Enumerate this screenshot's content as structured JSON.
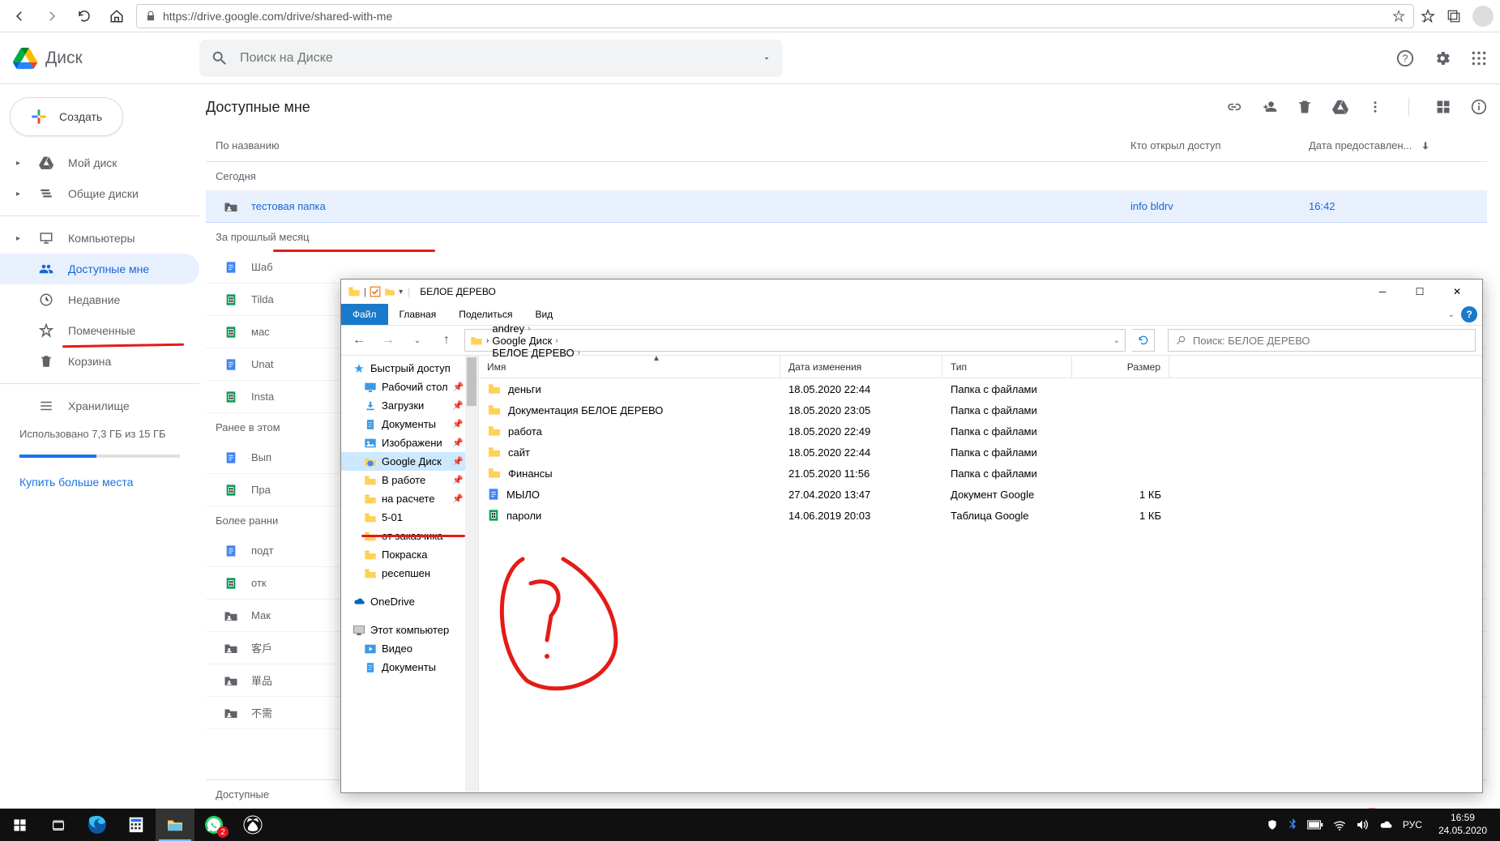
{
  "browser": {
    "url": "https://drive.google.com/drive/shared-with-me"
  },
  "drive": {
    "app_name": "Диск",
    "search_placeholder": "Поиск на Диске",
    "create_label": "Создать",
    "sidebar": [
      {
        "label": "Мой диск",
        "active": false,
        "expandable": true
      },
      {
        "label": "Общие диски",
        "active": false,
        "expandable": true
      },
      {
        "label": "Компьютеры",
        "active": false,
        "expandable": true,
        "sep_before": true
      },
      {
        "label": "Доступные мне",
        "active": true,
        "expandable": false
      },
      {
        "label": "Недавние",
        "active": false,
        "expandable": false
      },
      {
        "label": "Помеченные",
        "active": false,
        "expandable": false
      },
      {
        "label": "Корзина",
        "active": false,
        "expandable": false
      },
      {
        "label": "Хранилище",
        "active": false,
        "expandable": false,
        "sep_before": true
      }
    ],
    "storage_text": "Использовано 7,3 ГБ из 15 ГБ",
    "storage_link": "Купить больше места",
    "main_title": "Доступные мне",
    "columns": {
      "name": "По названию",
      "owner": "Кто открыл доступ",
      "date": "Дата предоставлен..."
    },
    "groups": [
      {
        "label": "Сегодня",
        "rows": [
          {
            "name": "тестовая папка",
            "owner": "info bldrv",
            "date": "16:42",
            "type": "folder-shared",
            "selected": true
          }
        ]
      },
      {
        "label": "За прошлый месяц",
        "rows": [
          {
            "name": "Шаб",
            "type": "doc"
          },
          {
            "name": "Tilda",
            "type": "sheet"
          },
          {
            "name": "мас",
            "type": "sheet"
          },
          {
            "name": "Unat",
            "type": "doc"
          },
          {
            "name": "Insta",
            "type": "sheet"
          }
        ]
      },
      {
        "label": "Ранее в этом",
        "rows": [
          {
            "name": "Вып",
            "type": "doc"
          },
          {
            "name": "Пра",
            "type": "sheet"
          }
        ]
      },
      {
        "label": "Более ранни",
        "rows": [
          {
            "name": "подт",
            "type": "doc"
          },
          {
            "name": "отк",
            "type": "sheet"
          },
          {
            "name": "Мак",
            "type": "folder-shared"
          },
          {
            "name": "客戶",
            "type": "folder-shared"
          },
          {
            "name": "單品",
            "type": "folder-shared"
          },
          {
            "name": "不需",
            "type": "folder-shared"
          }
        ]
      }
    ],
    "footer_label": "Доступные"
  },
  "explorer": {
    "title": "БЕЛОЕ ДЕРЕВО",
    "tabs": {
      "file": "Файл",
      "home": "Главная",
      "share": "Поделиться",
      "view": "Вид"
    },
    "address": [
      "andrey",
      "Google Диск",
      "БЕЛОЕ ДЕРЕВО"
    ],
    "search_placeholder": "Поиск: БЕЛОЕ ДЕРЕВО",
    "columns": {
      "name": "Имя",
      "date": "Дата изменения",
      "type": "Тип",
      "size": "Размер"
    },
    "tree": [
      {
        "label": "Быстрый доступ",
        "icon": "star",
        "bold": true
      },
      {
        "label": "Рабочий стол",
        "icon": "desktop",
        "pin": true,
        "sub": true
      },
      {
        "label": "Загрузки",
        "icon": "download",
        "pin": true,
        "sub": true
      },
      {
        "label": "Документы",
        "icon": "docs",
        "pin": true,
        "sub": true
      },
      {
        "label": "Изображени",
        "icon": "pics",
        "pin": true,
        "sub": true
      },
      {
        "label": "Google Диск",
        "icon": "gdrive",
        "pin": true,
        "sub": true,
        "sel": true
      },
      {
        "label": "В работе",
        "icon": "gfolder",
        "pin": true,
        "sub": true
      },
      {
        "label": "на расчете",
        "icon": "gfolder",
        "pin": true,
        "sub": true
      },
      {
        "label": "5-01",
        "icon": "gfolder",
        "sub": true
      },
      {
        "label": "от заказчика",
        "icon": "gfolder",
        "sub": true
      },
      {
        "label": "Покраска",
        "icon": "gfolder",
        "sub": true
      },
      {
        "label": "ресепшен",
        "icon": "gfolder",
        "sub": true
      },
      {
        "label": "OneDrive",
        "icon": "onedrive",
        "bold": true,
        "gap_before": true
      },
      {
        "label": "Этот компьютер",
        "icon": "pc",
        "bold": true,
        "gap_before": true
      },
      {
        "label": "Видео",
        "icon": "video",
        "sub": true
      },
      {
        "label": "Документы",
        "icon": "docs",
        "sub": true
      }
    ],
    "rows": [
      {
        "name": "деньги",
        "date": "18.05.2020 22:44",
        "type": "Папка с файлами",
        "size": "",
        "icon": "gfolder"
      },
      {
        "name": "Документация БЕЛОЕ ДЕРЕВО",
        "date": "18.05.2020 23:05",
        "type": "Папка с файлами",
        "size": "",
        "icon": "gfolder"
      },
      {
        "name": "работа",
        "date": "18.05.2020 22:49",
        "type": "Папка с файлами",
        "size": "",
        "icon": "gfolder"
      },
      {
        "name": "сайт",
        "date": "18.05.2020 22:44",
        "type": "Папка с файлами",
        "size": "",
        "icon": "gfolder"
      },
      {
        "name": "Финансы",
        "date": "21.05.2020 11:56",
        "type": "Папка с файлами",
        "size": "",
        "icon": "gfolder"
      },
      {
        "name": "МЫЛО",
        "date": "27.04.2020 13:47",
        "type": "Документ Google",
        "size": "1 КБ",
        "icon": "gdoc"
      },
      {
        "name": "пароли",
        "date": "14.06.2019 20:03",
        "type": "Таблица Google",
        "size": "1 КБ",
        "icon": "gsheet"
      }
    ]
  },
  "taskbar": {
    "lang": "РУС",
    "time": "16:59",
    "date": "24.05.2020",
    "badge": "2"
  }
}
